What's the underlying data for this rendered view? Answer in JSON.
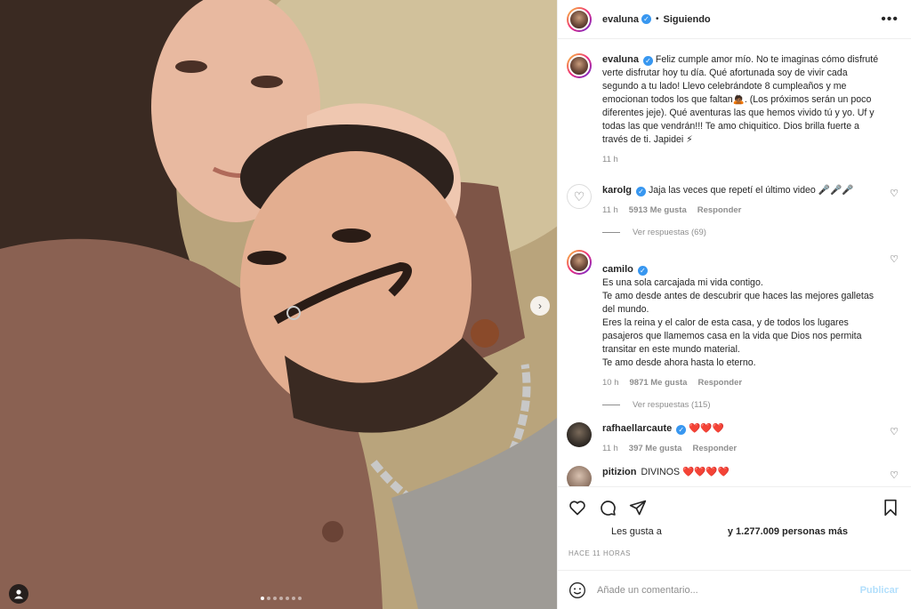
{
  "header": {
    "username": "evaluna",
    "separator": "•",
    "follow_status": "Siguiendo",
    "more": "•••"
  },
  "photo": {
    "next_icon": "chevron-right-icon",
    "tag_icon": "person-icon",
    "slide_count": 7,
    "current_slide": 1
  },
  "caption": {
    "username": "evaluna",
    "text": "Feliz cumple amor mío. No te imaginas cómo disfruté verte disfrutar hoy tu día. Qué afortunada soy de vivir cada segundo a tu lado! Llevo celebrándote 8 cumpleaños y me emocionan todos los que faltan🙇🏾. (Los próximos serán un poco diferentes jeje). Qué aventuras las que hemos vivido tú y yo. Uf y todas las que vendrán!!! Te amo chiquitico. Dios brilla fuerte a través de ti. Japidei ⚡",
    "time": "11 h"
  },
  "comments": [
    {
      "username": "karolg",
      "text": "Jaja las veces que repetí el último video 🎤🎤🎤",
      "time": "11 h",
      "likes": "5913 Me gusta",
      "reply": "Responder",
      "view_replies": "Ver respuestas (69)"
    },
    {
      "username": "camilo",
      "text": "Es una sola carcajada mi vida contigo.\nTe amo desde antes de descubrir que haces las mejores galletas del mundo.\nEres la reina y el calor de esta casa, y de todos los lugares pasajeros que llamemos casa en la vida que Dios nos permita transitar en este mundo material.\nTe amo desde ahora hasta lo eterno.",
      "time": "10 h",
      "likes": "9871 Me gusta",
      "reply": "Responder",
      "view_replies": "Ver respuestas (115)"
    },
    {
      "username": "rafhaellarcaute",
      "text": "❤️❤️❤️",
      "time": "11 h",
      "likes": "397 Me gusta",
      "reply": "Responder"
    },
    {
      "username": "pitizion",
      "text": "DIVINOS ❤️❤️❤️❤️"
    }
  ],
  "actions": {
    "likes_lead": "Les gusta a",
    "likes_count": "y 1.277.009 personas más",
    "timestamp": "HACE 11 HORAS"
  },
  "add_comment": {
    "placeholder": "Añade un comentario...",
    "publish": "Publicar"
  },
  "colors": {
    "accent": "#3897f0",
    "publish_disabled": "#b2dffc",
    "muted": "#8e8e8e"
  }
}
